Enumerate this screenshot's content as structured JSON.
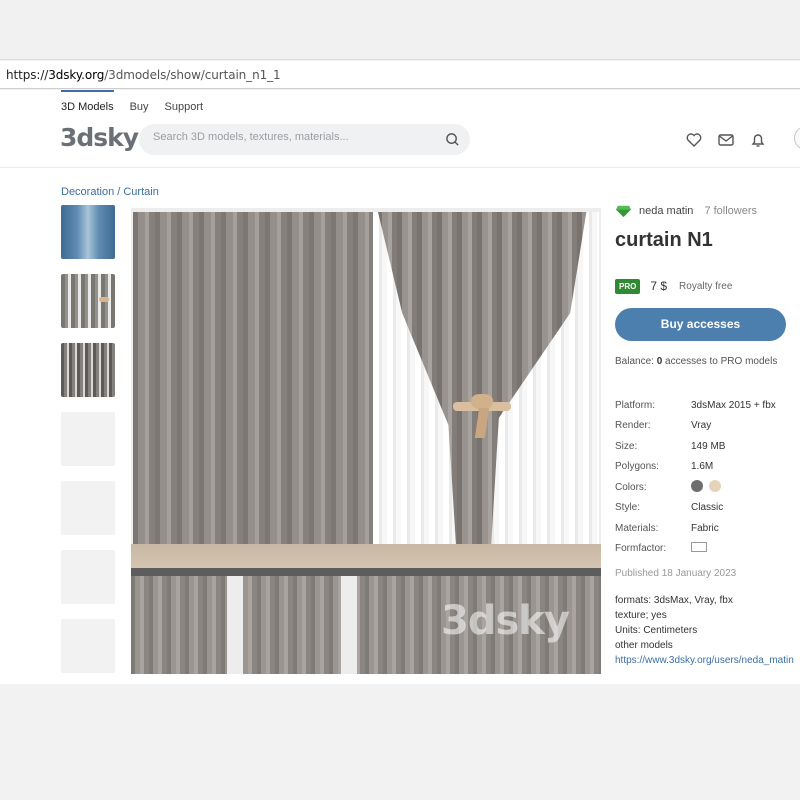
{
  "browser": {
    "url_prefix": "https://",
    "url_host": "3dsky.org",
    "url_path": "/3dmodels/show/curtain_n1_1"
  },
  "header": {
    "nav": [
      "3D Models",
      "Buy",
      "Support"
    ],
    "logo": "3dsky",
    "search_placeholder": "Search 3D models, textures, materials...",
    "icons": [
      "heart-icon",
      "mail-icon",
      "bell-icon"
    ]
  },
  "breadcrumb": "Decoration / Curtain",
  "gallery": {
    "watermark": "3dsky"
  },
  "product": {
    "author": "neda matin",
    "followers": "7 followers",
    "title": "curtain N1",
    "badge": "PRO",
    "price": "7 $",
    "license": "Royalty free",
    "buy_label": "Buy accesses",
    "balance_prefix": "Balance:",
    "balance_count": "0",
    "balance_suffix": "accesses to PRO models",
    "specs": [
      {
        "k": "Platform:",
        "v": "3dsMax 2015 + fbx"
      },
      {
        "k": "Render:",
        "v": "Vray"
      },
      {
        "k": "Size:",
        "v": "149 MB"
      },
      {
        "k": "Polygons:",
        "v": "1.6M"
      },
      {
        "k": "Colors:",
        "v": ""
      },
      {
        "k": "Style:",
        "v": "Classic"
      },
      {
        "k": "Materials:",
        "v": "Fabric"
      },
      {
        "k": "Formfactor:",
        "v": ""
      }
    ],
    "colors": [
      "#6e6e6e",
      "#e6d3bc"
    ],
    "published": "Published 18 January 2023",
    "description": [
      "formats: 3dsMax, Vray, fbx",
      "texture; yes",
      "Units: Centimeters",
      "other models"
    ],
    "profile_link": "https://www.3dsky.org/users/neda_matin"
  },
  "accent": "#4d7fae"
}
